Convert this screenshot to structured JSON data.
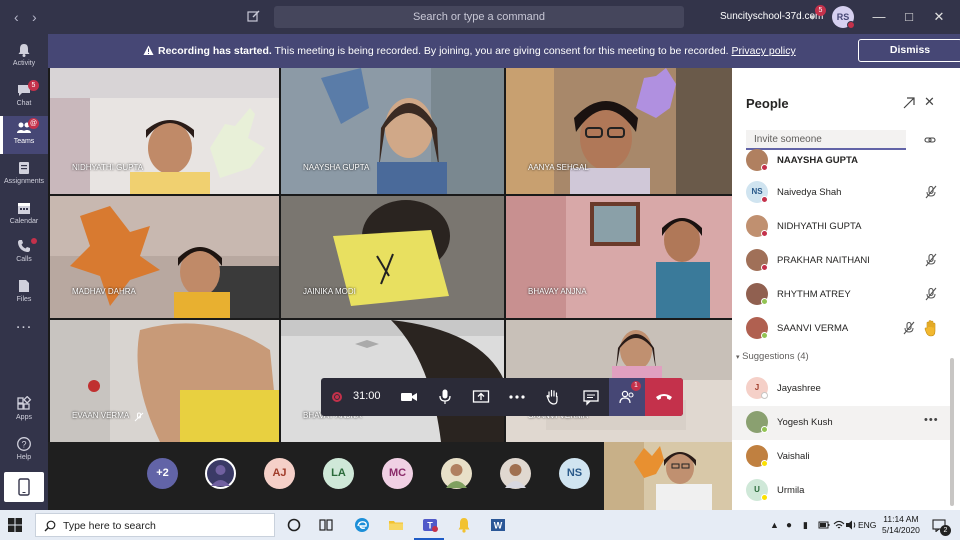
{
  "titlebar": {
    "search_placeholder": "Search or type a command",
    "org_name": "Suncityschool-37d.com",
    "org_badge": "5",
    "me_initials": "RS"
  },
  "rail": {
    "items": [
      {
        "label": "Activity",
        "icon": "bell-icon"
      },
      {
        "label": "Chat",
        "icon": "chat-icon",
        "badge": "5"
      },
      {
        "label": "Teams",
        "icon": "teams-icon",
        "badge": "@"
      },
      {
        "label": "Assignments",
        "icon": "assignments-icon"
      },
      {
        "label": "Calendar",
        "icon": "calendar-icon"
      },
      {
        "label": "Calls",
        "icon": "phone-icon"
      },
      {
        "label": "Files",
        "icon": "files-icon"
      },
      {
        "label": "...",
        "icon": "more-icon"
      },
      {
        "label": "Apps",
        "icon": "apps-icon"
      },
      {
        "label": "Help",
        "icon": "help-icon"
      }
    ]
  },
  "banner": {
    "bold": "Recording has started.",
    "text": " This meeting is being recorded. By joining, you are giving consent for this meeting to be recorded. ",
    "link": "Privacy policy",
    "dismiss": "Dismiss"
  },
  "tiles": [
    {
      "name": "NIDHYATHI GUPTA"
    },
    {
      "name": "NAAYSHA GUPTA"
    },
    {
      "name": "AANYA SEHGAL"
    },
    {
      "name": "MADHAV DAHRA"
    },
    {
      "name": "JAINIKA MODI"
    },
    {
      "name": "BHAVAY ANJNA"
    },
    {
      "name": "EVAAN VERMA"
    },
    {
      "name": "BHAVAY ANJNA"
    },
    {
      "name": "SAANVI VERMA"
    }
  ],
  "callbar": {
    "timer": "31:00",
    "people_badge": "1"
  },
  "strip": [
    {
      "label": "+2",
      "bg": "#6264a7",
      "fg": "#ffffff"
    },
    {
      "label": "",
      "bg": "#3a3a66",
      "fg": "#ffffff"
    },
    {
      "label": "AJ",
      "bg": "#f5d0c8",
      "fg": "#a03c2a"
    },
    {
      "label": "LA",
      "bg": "#cfe8d8",
      "fg": "#2a6a3a"
    },
    {
      "label": "MC",
      "bg": "#f0d0e4",
      "fg": "#8a2a6a"
    },
    {
      "label": "",
      "bg": "#e8e0c8",
      "fg": "#333"
    },
    {
      "label": "",
      "bg": "#e0d8d0",
      "fg": "#333"
    },
    {
      "label": "NS",
      "bg": "#d0e4f0",
      "fg": "#2a5a8a"
    }
  ],
  "people": {
    "title": "People",
    "invite_placeholder": "Invite someone",
    "participants": [
      {
        "name": "NAAYSHA GUPTA",
        "initials": "",
        "bold": true,
        "mute": false,
        "hand": false,
        "av_bg": "#b08060"
      },
      {
        "name": "Naivedya Shah",
        "initials": "NS",
        "bold": false,
        "mute": true,
        "hand": false,
        "av_bg": "#d0e4f0"
      },
      {
        "name": "NIDHYATHI GUPTA",
        "initials": "",
        "bold": false,
        "mute": false,
        "hand": false,
        "av_bg": "#c09070"
      },
      {
        "name": "PRAKHAR NAITHANI",
        "initials": "",
        "bold": false,
        "mute": true,
        "hand": false,
        "av_bg": "#a07058"
      },
      {
        "name": "RHYTHM ATREY",
        "initials": "",
        "bold": false,
        "mute": true,
        "hand": false,
        "av_bg": "#906050"
      },
      {
        "name": "SAANVI VERMA",
        "initials": "",
        "bold": false,
        "mute": true,
        "hand": true,
        "av_bg": "#b06050"
      }
    ],
    "suggestions_label": "Suggestions (4)",
    "suggestions": [
      {
        "name": "Jayashree",
        "initials": "J",
        "av_bg": "#f5d0c8",
        "more": false
      },
      {
        "name": "Yogesh Kush",
        "initials": "",
        "av_bg": "#8aa070",
        "more": true
      },
      {
        "name": "Vaishali",
        "initials": "",
        "av_bg": "#c08040",
        "more": false
      },
      {
        "name": "Urmila",
        "initials": "U",
        "av_bg": "#cfe8d8",
        "more": false
      }
    ]
  },
  "taskbar": {
    "search_placeholder": "Type here to search",
    "time": "11:14 AM",
    "date": "5/14/2020",
    "lang": "ENG",
    "notif_count": "2"
  }
}
